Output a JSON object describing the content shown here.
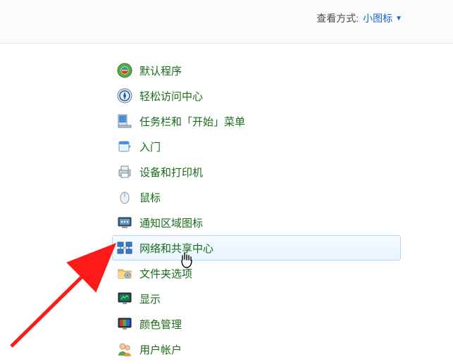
{
  "topbar": {
    "view_label": "查看方式:",
    "view_mode": "小图标"
  },
  "items": [
    {
      "id": "default-programs",
      "label": "默认程序"
    },
    {
      "id": "ease-of-access",
      "label": "轻松访问中心"
    },
    {
      "id": "taskbar-start",
      "label": "任务栏和「开始」菜单"
    },
    {
      "id": "getting-started",
      "label": "入门"
    },
    {
      "id": "devices-printers",
      "label": "设备和打印机"
    },
    {
      "id": "mouse",
      "label": "鼠标"
    },
    {
      "id": "notification-icons",
      "label": "通知区域图标"
    },
    {
      "id": "network-sharing",
      "label": "网络和共享中心",
      "hovered": true
    },
    {
      "id": "folder-options",
      "label": "文件夹选项"
    },
    {
      "id": "display",
      "label": "显示"
    },
    {
      "id": "color-management",
      "label": "颜色管理"
    },
    {
      "id": "user-accounts",
      "label": "用户帐户"
    }
  ]
}
